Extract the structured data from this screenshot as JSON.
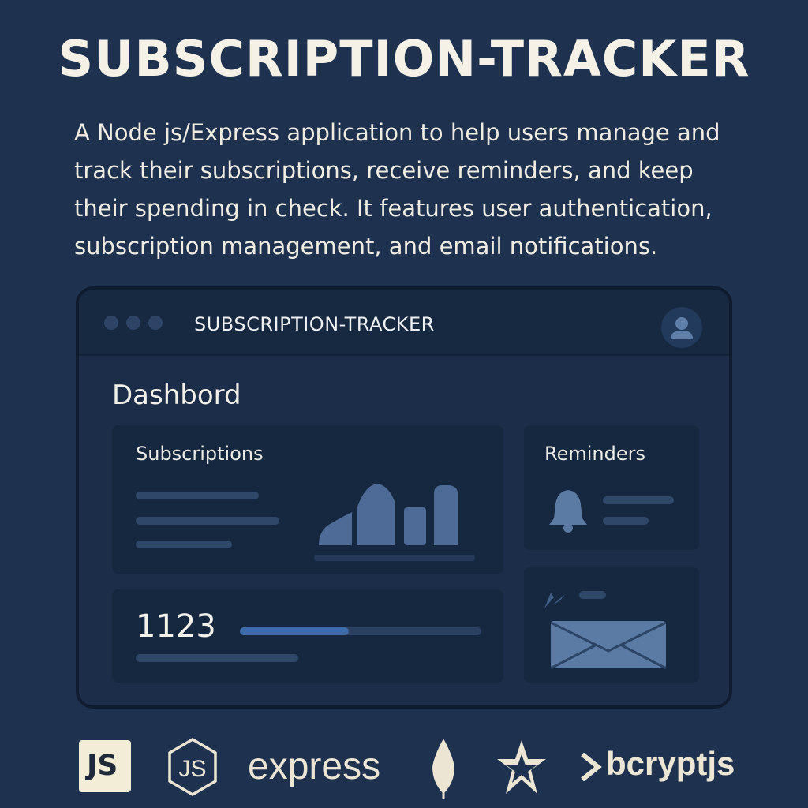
{
  "header": {
    "title": "SUBSCRIPTION-TRACKER",
    "description": "A Node js/Express application to help users manage and track their subscriptions, receive reminders, and keep their spending in check. It features user authentication, subscription management, and email notifications."
  },
  "window": {
    "title": "SUBSCRIPTION-TRACKER",
    "avatar_icon": "user-icon"
  },
  "dashboard": {
    "heading": "Dashbord",
    "subscriptions_label": "Subscriptions",
    "reminders_label": "Reminders",
    "count": "1123",
    "count_progress": 0.45
  },
  "tech_logos": {
    "js_label": "JS",
    "express_label": "express",
    "bcrypt_label": "bcryptjs",
    "icons": [
      "javascript-logo",
      "nodejs-logo",
      "express-logo",
      "mongodb-logo",
      "arcjet-logo",
      "bcryptjs-logo"
    ]
  },
  "colors": {
    "background": "#1e3250",
    "accent": "#3d6aa8"
  }
}
